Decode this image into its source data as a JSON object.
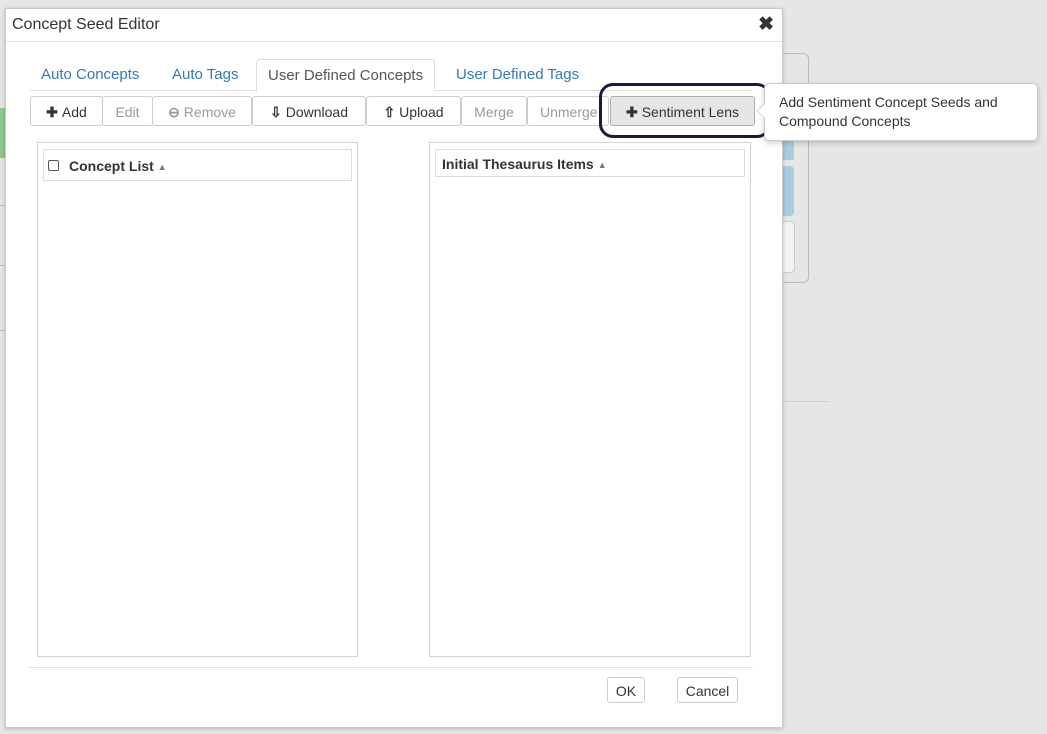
{
  "dialog": {
    "title": "Concept Seed Editor",
    "close_icon": "close-icon"
  },
  "tabs": [
    {
      "label": "Auto Concepts",
      "active": false
    },
    {
      "label": "Auto Tags",
      "active": false
    },
    {
      "label": "User Defined Concepts",
      "active": true
    },
    {
      "label": "User Defined Tags",
      "active": false
    }
  ],
  "toolbar": {
    "add": "Add",
    "edit": "Edit",
    "remove": "Remove",
    "download": "Download",
    "upload": "Upload",
    "merge": "Merge",
    "unmerge": "Unmerge",
    "sentiment_lens": "Sentiment Lens"
  },
  "icons": {
    "add": "plus-icon",
    "remove": "minus-circle-icon",
    "download": "download-icon",
    "upload": "upload-icon",
    "sentiment_lens": "plus-icon"
  },
  "concept_list": {
    "header": "Concept List"
  },
  "thesaurus": {
    "header": "Initial Thesaurus Items"
  },
  "footer": {
    "ok": "OK",
    "cancel": "Cancel"
  },
  "tooltip": {
    "line1": "Add Sentiment Concept Seeds and",
    "line2": "Compound Concepts"
  },
  "colors": {
    "link": "#337ab7",
    "highlight_ring": "#1c1844"
  }
}
